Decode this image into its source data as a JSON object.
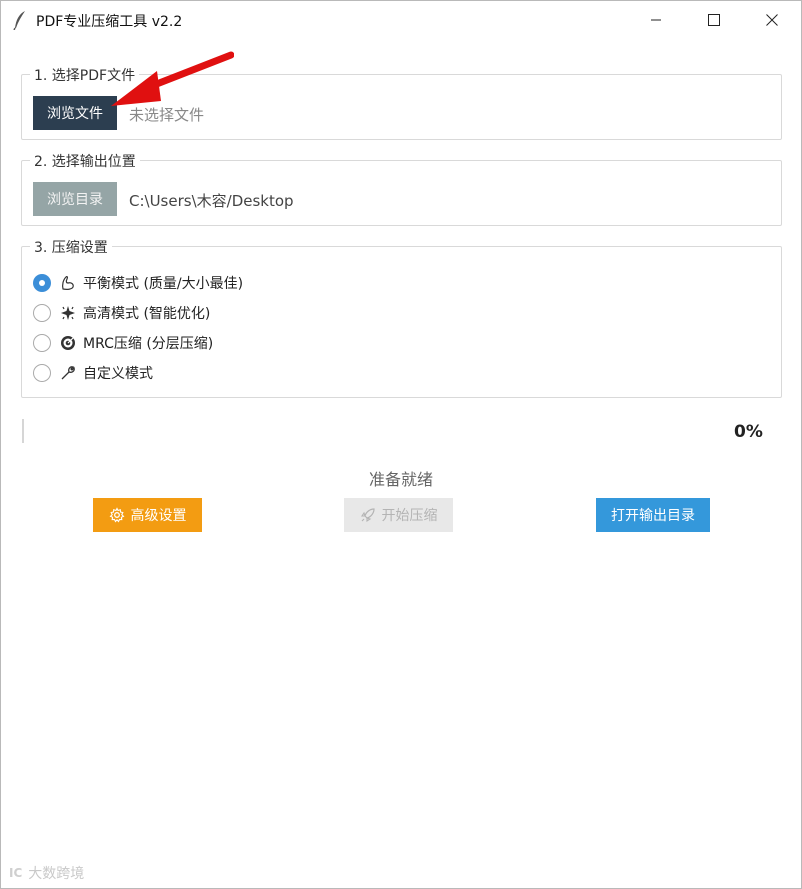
{
  "window": {
    "title": "PDF专业压缩工具 v2.2",
    "icons": {
      "app": "feather-icon",
      "minimize": "minimize-icon",
      "maximize": "maximize-icon",
      "close": "close-icon"
    }
  },
  "section_file": {
    "legend": "1. 选择PDF文件",
    "browse_label": "浏览文件",
    "file_status": "未选择文件"
  },
  "section_output": {
    "legend": "2. 选择输出位置",
    "browse_label": "浏览目录",
    "output_path": "C:\\Users\\木容/Desktop"
  },
  "section_compress": {
    "legend": "3. 压缩设置",
    "options": [
      {
        "label": "平衡模式 (质量/大小最佳)",
        "icon": "bicep-icon",
        "selected": true
      },
      {
        "label": "高清模式 (智能优化)",
        "icon": "sparkle-icon",
        "selected": false
      },
      {
        "label": "MRC压缩 (分层压缩)",
        "icon": "target-icon",
        "selected": false
      },
      {
        "label": "自定义模式",
        "icon": "wrench-icon",
        "selected": false
      }
    ]
  },
  "progress": {
    "value": 0,
    "label": "0%"
  },
  "status_text": "准备就绪",
  "actions": {
    "advanced_label": "高级设置",
    "start_label": "开始压缩",
    "open_label": "打开输出目录"
  },
  "watermark": {
    "logo": "IC",
    "text": "大数跨境"
  },
  "colors": {
    "dark_button": "#2c3e50",
    "gray_button": "#95a5a6",
    "orange": "#f39c12",
    "blue": "#3498db",
    "radio_selected": "#3b8ed8",
    "annotation_arrow": "#e01010"
  }
}
